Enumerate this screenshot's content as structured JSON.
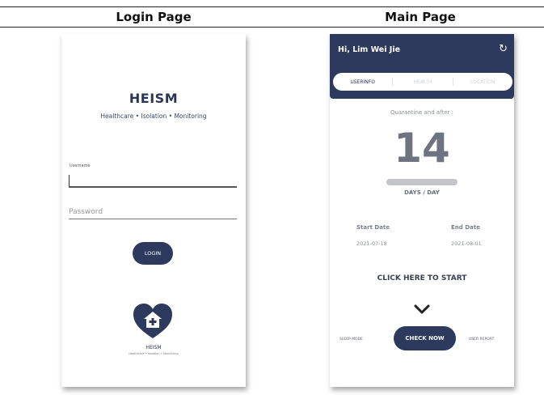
{
  "table": {
    "left_heading": "Login Page",
    "right_heading": "Main Page"
  },
  "login": {
    "app_name": "HEISM",
    "tagline": "Healthcare • Isolation • Monitoring",
    "username_label": "Username",
    "username_value": "",
    "password_placeholder": "Password",
    "login_button": "LOGIN",
    "logo_name": "HEISM",
    "logo_tagline": "Healthcare • Isolation • Monitoring"
  },
  "main": {
    "greeting": "Hi, Lim Wei Jie",
    "refresh_icon": "refresh-icon",
    "tabs": [
      {
        "label": "USERINFO",
        "active": true
      },
      {
        "label": "HEALTH",
        "active": false
      },
      {
        "label": "LOCATION",
        "active": false
      }
    ],
    "quarantine_label": "Quarantine and after :",
    "days_count": "14",
    "days_unit": "DAYS / DAY",
    "progress_fraction": 1.0,
    "start_label": "Start Date",
    "start_value": "2021-07-18",
    "end_label": "End Date",
    "end_value": "2021-08-01",
    "click_text": "CLICK HERE TO START",
    "chevron_icon": "chevron-down-icon",
    "sleep_mode": "SLEEP MODE",
    "check_now": "CHECK NOW",
    "user_report": "USER REPORT"
  },
  "colors": {
    "primary": "#2d3a5e",
    "muted": "#6f7380"
  }
}
